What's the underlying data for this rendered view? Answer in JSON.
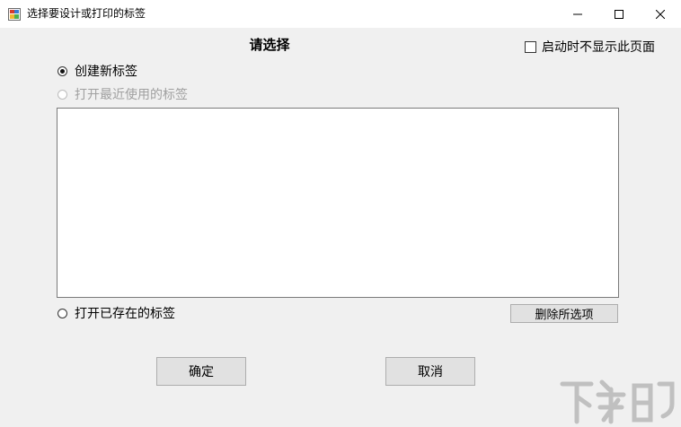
{
  "window": {
    "title": "选择要设计或打印的标签",
    "minimize_glyph": "─",
    "maximize_glyph": "☐",
    "close_glyph": "✕"
  },
  "header": {
    "title": "请选择",
    "startup_checkbox_label": "启动时不显示此页面",
    "startup_checked": false
  },
  "options": {
    "create_new": "创建新标签",
    "open_recent": "打开最近使用的标签",
    "open_existing": "打开已存在的标签",
    "selected": "create_new"
  },
  "recent_list": {
    "items": []
  },
  "buttons": {
    "delete_selected": "删除所选项",
    "ok": "确定",
    "cancel": "取消"
  },
  "watermark": {
    "text": "下载吧",
    "icon": "download-watermark-logo"
  },
  "colors": {
    "window_bg": "#f0f0f0",
    "titlebar_bg": "#ffffff",
    "button_bg": "#e1e1e1",
    "disabled_text": "#a0a0a0"
  }
}
